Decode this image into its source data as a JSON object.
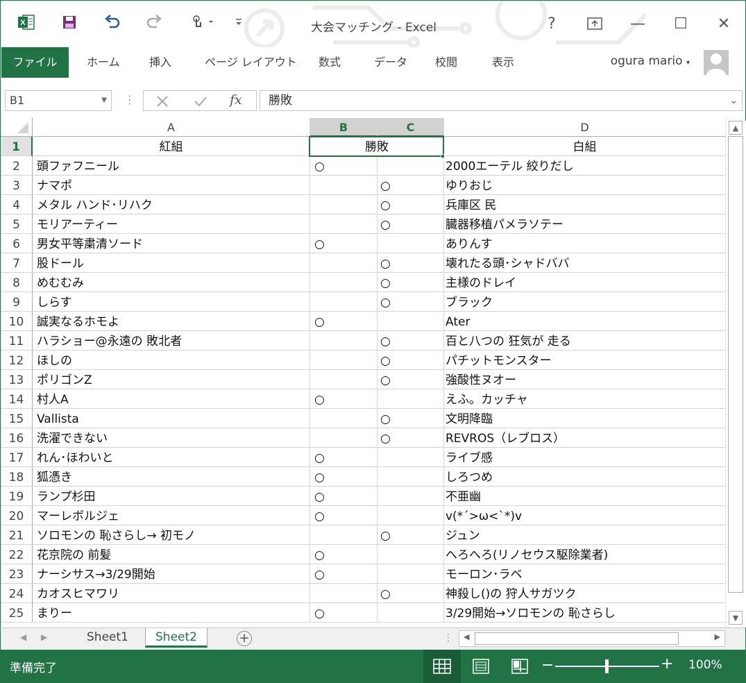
{
  "window": {
    "title": "大会マッチング - Excel"
  },
  "titlebar": {
    "help": "?",
    "minimize": "—",
    "maximize": "☐",
    "close": "✕"
  },
  "ribbon": {
    "tabs": [
      "ファイル",
      "ホーム",
      "挿入",
      "ページ レイアウト",
      "数式",
      "データ",
      "校閲",
      "表示"
    ],
    "user": "ogura mario"
  },
  "formula_bar": {
    "name_box": "B1",
    "formula": "勝敗",
    "fx": "fx"
  },
  "columns": [
    "A",
    "B",
    "C",
    "D"
  ],
  "header_row": {
    "a": "紅組",
    "bc": "勝敗",
    "d": "白組"
  },
  "rows": [
    {
      "n": "2",
      "a": "頭ファフニール",
      "b": "○",
      "c": "",
      "d": "2000エーテル 絞りだし"
    },
    {
      "n": "3",
      "a": "ナマポ",
      "b": "",
      "c": "○",
      "d": "ゆりおじ"
    },
    {
      "n": "4",
      "a": "メタル ハンド･リハク",
      "b": "",
      "c": "○",
      "d": "兵庫区 民"
    },
    {
      "n": "5",
      "a": "モリアーティー",
      "b": "",
      "c": "○",
      "d": "臓器移植パメラソテー"
    },
    {
      "n": "6",
      "a": "男女平等粛清ソード",
      "b": "○",
      "c": "",
      "d": "ありんす"
    },
    {
      "n": "7",
      "a": "股ドール",
      "b": "",
      "c": "○",
      "d": "壊れたる頭･シャドババ"
    },
    {
      "n": "8",
      "a": "めむむみ",
      "b": "",
      "c": "○",
      "d": "主様のドレイ"
    },
    {
      "n": "9",
      "a": "しらす",
      "b": "",
      "c": "○",
      "d": "ブラック"
    },
    {
      "n": "10",
      "a": "誠実なるホモよ",
      "b": "○",
      "c": "",
      "d": "Ater"
    },
    {
      "n": "11",
      "a": "ハラショー@永遠の 敗北者",
      "b": "",
      "c": "○",
      "d": "百と八つの 狂気が 走る"
    },
    {
      "n": "12",
      "a": "ほしの",
      "b": "",
      "c": "○",
      "d": "パチットモンスター"
    },
    {
      "n": "13",
      "a": "ポリゴンZ",
      "b": "",
      "c": "○",
      "d": "強酸性ヌオー"
    },
    {
      "n": "14",
      "a": "村人A",
      "b": "○",
      "c": "",
      "d": "えふ。カッチャ"
    },
    {
      "n": "15",
      "a": "Vallista",
      "b": "",
      "c": "○",
      "d": "文明降臨"
    },
    {
      "n": "16",
      "a": "洗濯できない",
      "b": "",
      "c": "○",
      "d": "REVROS（レブロス）"
    },
    {
      "n": "17",
      "a": "れん･ほわいと",
      "b": "○",
      "c": "",
      "d": "ライブ感"
    },
    {
      "n": "18",
      "a": "狐憑き",
      "b": "○",
      "c": "",
      "d": "しろつめ"
    },
    {
      "n": "19",
      "a": "ランプ杉田",
      "b": "○",
      "c": "",
      "d": "不亜幽"
    },
    {
      "n": "20",
      "a": "マーレボルジェ",
      "b": "○",
      "c": "",
      "d": "v(*´>ω<`*)v"
    },
    {
      "n": "21",
      "a": "ソロモンの 恥さらし→ 初モノ",
      "b": "",
      "c": "○",
      "d": "ジュン"
    },
    {
      "n": "22",
      "a": "花京院の 前髪",
      "b": "○",
      "c": "",
      "d": "へろへろ(リノセウス駆除業者)"
    },
    {
      "n": "23",
      "a": "ナーシサス→3/29開始",
      "b": "○",
      "c": "",
      "d": "モーロン･ラベ"
    },
    {
      "n": "24",
      "a": "カオスヒマワリ",
      "b": "",
      "c": "○",
      "d": "神殺し()の 狩人サガツク"
    },
    {
      "n": "25",
      "a": "まりー",
      "b": "○",
      "c": "",
      "d": "3/29開始→ソロモンの 恥さらし"
    }
  ],
  "sheets": [
    "Sheet1",
    "Sheet2"
  ],
  "active_sheet": "Sheet2",
  "status": {
    "ready": "準備完了",
    "zoom": "100%",
    "zoom_level": 0.5
  },
  "colors": {
    "accent": "#217346",
    "selected_header": "#d2d2d2"
  },
  "icons": [
    "excel-logo-icon",
    "save-icon",
    "undo-icon",
    "redo-icon",
    "touch-mode-icon",
    "customize-qat-icon",
    "ribbon-display-icon",
    "cancel-icon",
    "enter-icon",
    "fx-icon",
    "add-sheet-icon",
    "normal-view-icon",
    "page-layout-view-icon",
    "page-break-view-icon"
  ]
}
